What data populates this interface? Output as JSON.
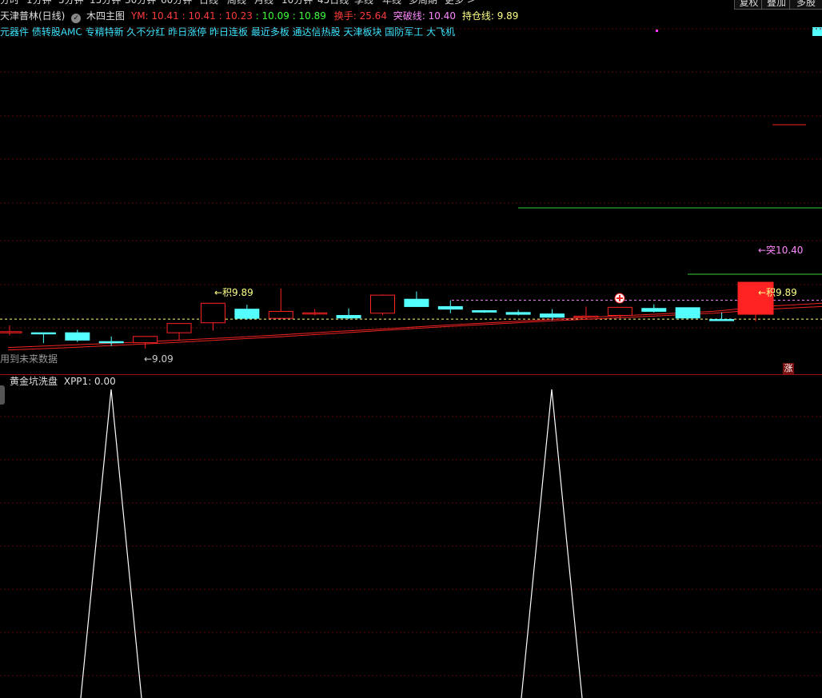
{
  "periods": [
    "分时",
    "1分钟",
    "5分钟",
    "15分钟",
    "30分钟",
    "60分钟",
    "日线",
    "周线",
    "月线",
    "10分钟",
    "45日线",
    "季线",
    "年线",
    "多周期",
    "更多 >"
  ],
  "right_buttons": [
    "复权",
    "叠加",
    "多股"
  ],
  "header": {
    "stock": "天津普林(日线)",
    "indicator": "木四主图",
    "ym_label": "YM: ",
    "ym_values": [
      "10.41",
      "10.41",
      "10.23",
      "10.09",
      "10.89"
    ],
    "turnover_label": "换手: ",
    "turnover_value": "25.64",
    "breakout_label": "突破线: ",
    "breakout_value": "10.40",
    "hold_label": "持仓线: ",
    "hold_value": "9.89"
  },
  "concepts": "元器件 债转股AMC 专精特新 久不分红 昨日涨停 昨日连板 最近多板 通达信热股 天津板块 国防军工 大飞机",
  "annotations": {
    "ji_left": "←积9.89",
    "ji_right": "←积9.89",
    "tu_right": "←突10.40",
    "low_label": "←9.09",
    "future_data": "用到未来数据",
    "zhang": "涨"
  },
  "sub_panel": {
    "name": "黄金坑洗盘",
    "label": "XPP1: 0.00"
  },
  "colors": {
    "up": "#ff2222",
    "down": "#54ffff",
    "ma": "#ee2222",
    "green_line": "#33cc33",
    "breakout": "#ff88ff",
    "hold": "#ffff88"
  },
  "chart_data": {
    "type": "candlestick",
    "price_levels": {
      "breakout": 10.4,
      "hold": 9.89,
      "low_marker": 9.09
    },
    "candles": [
      {
        "o": 9.55,
        "h": 9.72,
        "l": 9.45,
        "c": 9.55,
        "dir": "up"
      },
      {
        "o": 9.52,
        "h": 9.52,
        "l": 9.24,
        "c": 9.52,
        "dir": "down"
      },
      {
        "o": 9.52,
        "h": 9.6,
        "l": 9.27,
        "c": 9.32,
        "dir": "down"
      },
      {
        "o": 9.28,
        "h": 9.42,
        "l": 9.16,
        "c": 9.28,
        "dir": "down"
      },
      {
        "o": 9.25,
        "h": 9.42,
        "l": 9.09,
        "c": 9.42,
        "dir": "up"
      },
      {
        "o": 9.52,
        "h": 9.77,
        "l": 9.32,
        "c": 9.77,
        "dir": "up"
      },
      {
        "o": 9.79,
        "h": 10.32,
        "l": 9.58,
        "c": 10.32,
        "dir": "up"
      },
      {
        "o": 10.16,
        "h": 10.28,
        "l": 9.87,
        "c": 9.91,
        "dir": "down"
      },
      {
        "o": 9.91,
        "h": 10.72,
        "l": 9.89,
        "c": 10.1,
        "dir": "up"
      },
      {
        "o": 10.05,
        "h": 10.16,
        "l": 9.99,
        "c": 10.06,
        "dir": "up"
      },
      {
        "o": 9.99,
        "h": 10.18,
        "l": 9.89,
        "c": 9.92,
        "dir": "down"
      },
      {
        "o": 10.05,
        "h": 10.56,
        "l": 10.0,
        "c": 10.54,
        "dir": "up"
      },
      {
        "o": 10.43,
        "h": 10.64,
        "l": 10.22,
        "c": 10.23,
        "dir": "down"
      },
      {
        "o": 10.23,
        "h": 10.4,
        "l": 10.05,
        "c": 10.16,
        "dir": "down"
      },
      {
        "o": 10.12,
        "h": 10.14,
        "l": 10.06,
        "c": 10.08,
        "dir": "down"
      },
      {
        "o": 10.07,
        "h": 10.14,
        "l": 9.99,
        "c": 10.02,
        "dir": "down"
      },
      {
        "o": 10.03,
        "h": 10.16,
        "l": 9.86,
        "c": 9.94,
        "dir": "down"
      },
      {
        "o": 9.94,
        "h": 10.23,
        "l": 9.9,
        "c": 9.97,
        "dir": "up"
      },
      {
        "o": 9.99,
        "h": 10.21,
        "l": 9.93,
        "c": 10.21,
        "dir": "up"
      },
      {
        "o": 10.18,
        "h": 10.29,
        "l": 10.07,
        "c": 10.1,
        "dir": "down"
      },
      {
        "o": 10.2,
        "h": 10.2,
        "l": 9.89,
        "c": 9.92,
        "dir": "down"
      },
      {
        "o": 9.88,
        "h": 10.07,
        "l": 9.84,
        "c": 9.85,
        "dir": "down"
      },
      {
        "o": 10.02,
        "h": 10.89,
        "l": 9.83,
        "c": 10.89,
        "dir": "up"
      }
    ],
    "ma_lines": [
      {
        "values": [
          9.05,
          9.11,
          9.18,
          9.25,
          9.33,
          9.41,
          9.5,
          9.59,
          9.68,
          9.76,
          9.84,
          9.91,
          9.98,
          10.05,
          10.16,
          10.23
        ]
      },
      {
        "values": [
          9.12,
          9.18,
          9.24,
          9.31,
          9.38,
          9.46,
          9.55,
          9.63,
          9.72,
          9.8,
          9.88,
          9.96,
          10.03,
          10.1,
          10.24,
          10.32
        ]
      }
    ],
    "sub_indicator": {
      "name": "XPP1",
      "peaks": [
        1,
        1
      ],
      "baseline": 0
    }
  }
}
